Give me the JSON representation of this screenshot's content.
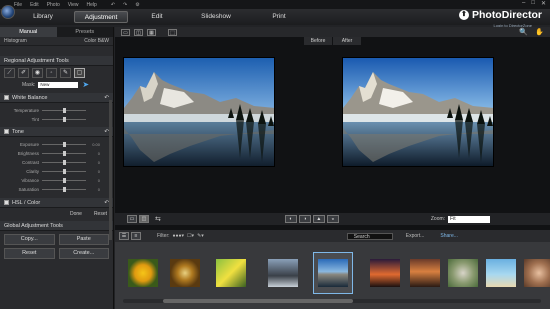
{
  "menu": [
    "File",
    "Edit",
    "Photo",
    "View",
    "Help"
  ],
  "modules": {
    "library": "Library",
    "adjustment": "Adjustment",
    "edit": "Edit",
    "slideshow": "Slideshow",
    "print": "Print"
  },
  "brand": {
    "name": "PhotoDirector",
    "sub": "Login to DirectorZone"
  },
  "left": {
    "tabs": {
      "manual": "Manual",
      "presets": "Presets"
    },
    "histogram": {
      "label": "Histogram",
      "color": "Color",
      "bw": "B&W"
    },
    "regional": "Regional Adjustment Tools",
    "mask": {
      "label": "Mask:",
      "value": "New"
    },
    "white_balance": "White Balance",
    "wb_sliders": [
      {
        "label": "Temperature",
        "pos": 0.5
      },
      {
        "label": "Tint",
        "pos": 0.5
      }
    ],
    "tone": "Tone",
    "tone_sliders": [
      {
        "label": "Exposure",
        "pos": 0.5,
        "value": "0.00"
      },
      {
        "label": "Brightness",
        "pos": 0.5,
        "value": "0"
      },
      {
        "label": "Contrast",
        "pos": 0.5,
        "value": "0"
      },
      {
        "label": "Clarity",
        "pos": 0.5,
        "value": "0"
      },
      {
        "label": "Vibrance",
        "pos": 0.5,
        "value": "0"
      },
      {
        "label": "Saturation",
        "pos": 0.5,
        "value": "0"
      }
    ],
    "hsl": "HSL / Color",
    "done": "Done",
    "reset": "Reset",
    "global": "Global Adjustment Tools",
    "copy": "Copy...",
    "paste": "Paste",
    "reset2": "Reset",
    "create": "Create..."
  },
  "main": {
    "before": "Before",
    "after": "After",
    "zoom_label": "Zoom:",
    "zoom_value": "Fit"
  },
  "film": {
    "filter": "Filter:",
    "search_placeholder": "Search",
    "export": "Export...",
    "share": "Share..."
  },
  "colors": {
    "accent": "#7fb8e8",
    "bg": "#222326"
  }
}
